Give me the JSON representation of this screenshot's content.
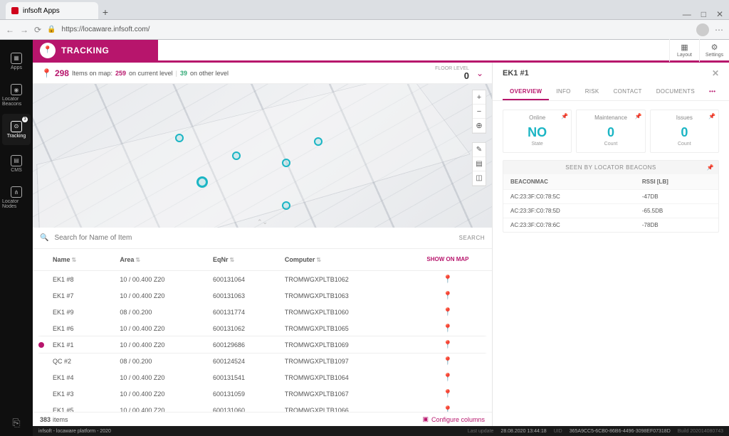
{
  "browser": {
    "tab_title": "infsoft Apps",
    "url": "https://locaware.infsoft.com/"
  },
  "sidebar": {
    "items": [
      {
        "label": "Apps"
      },
      {
        "label": "Locator Beacons"
      },
      {
        "label": "Tracking",
        "badge": "3"
      },
      {
        "label": "CMS"
      },
      {
        "label": "Locator Nodes"
      }
    ]
  },
  "header": {
    "title": "TRACKING",
    "layout_btn": "Layout",
    "settings_btn": "Settings"
  },
  "summary": {
    "total": "298",
    "total_label": "Items on map:",
    "current": "259",
    "current_label": "on current level",
    "other": "39",
    "other_label": "on other level",
    "floor_label": "FLOOR LEVEL",
    "floor_value": "0"
  },
  "search": {
    "placeholder": "Search for Name of Item",
    "button": "SEARCH"
  },
  "table": {
    "headers": {
      "name": "Name",
      "area": "Area",
      "eqnr": "EqNr",
      "computer": "Computer",
      "show": "SHOW ON MAP"
    },
    "rows": [
      {
        "name": "EK1 #8",
        "area": "10 / 00.400 Z20",
        "eqnr": "600131064",
        "computer": "TROMWGXPLTB1062",
        "selected": false
      },
      {
        "name": "EK1 #7",
        "area": "10 / 00.400 Z20",
        "eqnr": "600131063",
        "computer": "TROMWGXPLTB1063",
        "selected": false
      },
      {
        "name": "EK1 #9",
        "area": "08 / 00.200",
        "eqnr": "600131774",
        "computer": "TROMWGXPLTB1060",
        "selected": false
      },
      {
        "name": "EK1 #6",
        "area": "10 / 00.400 Z20",
        "eqnr": "600131062",
        "computer": "TROMWGXPLTB1065",
        "selected": false
      },
      {
        "name": "EK1 #1",
        "area": "10 / 00.400 Z20",
        "eqnr": "600129686",
        "computer": "TROMWGXPLTB1069",
        "selected": true
      },
      {
        "name": "QC #2",
        "area": "08 / 00.200",
        "eqnr": "600124524",
        "computer": "TROMWGXPLTB1097",
        "selected": false
      },
      {
        "name": "EK1 #4",
        "area": "10 / 00.400 Z20",
        "eqnr": "600131541",
        "computer": "TROMWGXPLTB1064",
        "selected": false
      },
      {
        "name": "EK1 #3",
        "area": "10 / 00.400 Z20",
        "eqnr": "600131059",
        "computer": "TROMWGXPLTB1067",
        "selected": false
      },
      {
        "name": "EK1 #5",
        "area": "10 / 00.400 Z20",
        "eqnr": "600131060",
        "computer": "TROMWGXPLTB1066",
        "selected": false
      }
    ],
    "footer_count": "383",
    "footer_label": "items",
    "configure": "Configure columns"
  },
  "detail": {
    "title": "EK1 #1",
    "tabs": [
      "OVERVIEW",
      "INFO",
      "RISK",
      "CONTACT",
      "DOCUMENTS"
    ],
    "stats": {
      "online_label": "Online",
      "online_value": "NO",
      "online_sub": "State",
      "maint_label": "Maintenance",
      "maint_value": "0",
      "maint_sub": "Count",
      "issues_label": "Issues",
      "issues_value": "0",
      "issues_sub": "Count"
    },
    "beacons": {
      "title": "SEEN BY LOCATOR BEACONS",
      "col1": "BEACONMAC",
      "col2": "RSSI [LB]",
      "rows": [
        {
          "mac": "AC:23:3F:C0:78:5C",
          "rssi": "-47DB"
        },
        {
          "mac": "AC:23:3F:C0:78:5D",
          "rssi": "-65.5DB"
        },
        {
          "mac": "AC:23:3F:C0:78:6C",
          "rssi": "-78DB"
        }
      ]
    }
  },
  "status": {
    "left": "infsoft - locaware platform - 2020",
    "update_label": "Last update",
    "update_val": "28.08.2020 13:44:18",
    "uid_label": "UID",
    "uid_val": "365A9CC5-6CB0-86B6-4496-3098EF07318D",
    "build": "Build 202014080743"
  }
}
